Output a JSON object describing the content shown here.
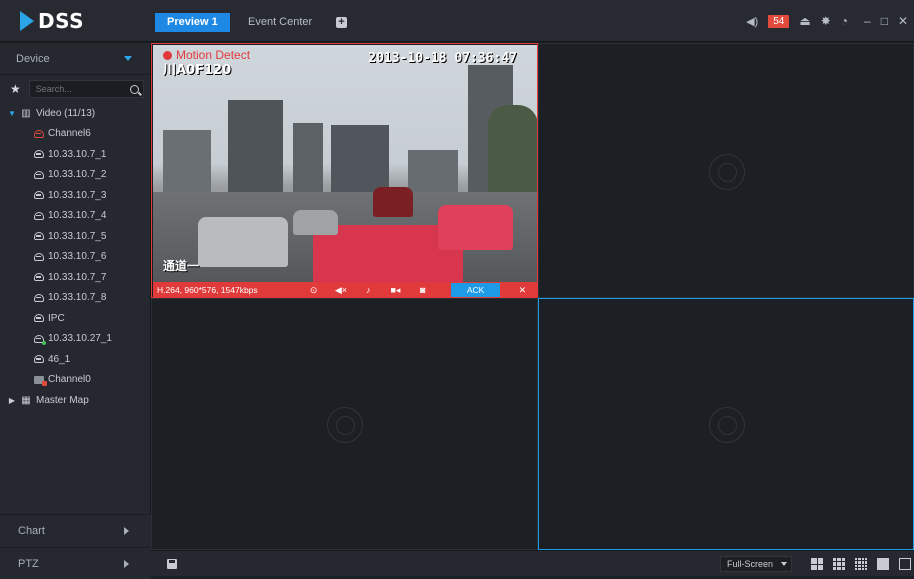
{
  "app": {
    "logo": "DSS"
  },
  "tabs": [
    {
      "label": "Preview 1",
      "active": true
    },
    {
      "label": "Event Center",
      "active": false
    }
  ],
  "header": {
    "alarm_count": "54"
  },
  "sidebar": {
    "title": "Device",
    "search_placeholder": "Search...",
    "tree": {
      "root_label": "Video (11/13)",
      "channels": [
        {
          "label": "Channel6",
          "status": "alarm"
        },
        {
          "label": "10.33.10.7_1",
          "status": "online"
        },
        {
          "label": "10.33.10.7_2",
          "status": "online"
        },
        {
          "label": "10.33.10.7_3",
          "status": "online"
        },
        {
          "label": "10.33.10.7_4",
          "status": "online"
        },
        {
          "label": "10.33.10.7_5",
          "status": "online"
        },
        {
          "label": "10.33.10.7_6",
          "status": "online"
        },
        {
          "label": "10.33.10.7_7",
          "status": "online"
        },
        {
          "label": "10.33.10.7_8",
          "status": "online"
        },
        {
          "label": "IPC",
          "status": "online"
        },
        {
          "label": "10.33.10.27_1",
          "status": "recording"
        },
        {
          "label": "46_1",
          "status": "online"
        },
        {
          "label": "Channel0",
          "status": "offline"
        }
      ],
      "map_label": "Master Map"
    },
    "footer": {
      "chart": "Chart",
      "ptz": "PTZ"
    }
  },
  "video": {
    "osd_motion": "Motion Detect",
    "osd_id": "川A0F120",
    "osd_timestamp": "2013-10-18 07:36:47",
    "osd_channel_text": "通道一",
    "stream_info": "H.264, 960*576, 1547kbps",
    "ack_label": "ACK"
  },
  "bottombar": {
    "fullscreen_label": "Full-Screen"
  },
  "colors": {
    "accent": "#1e88e5",
    "alarm": "#e03a3a",
    "active_pane": "#1e9be6"
  }
}
